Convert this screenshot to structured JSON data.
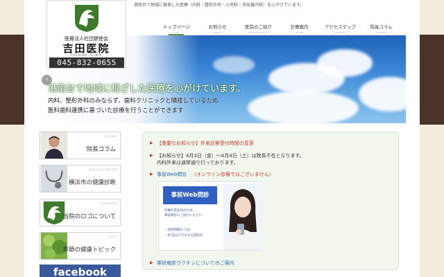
{
  "header": {
    "tagline": "港南台で地域に根差した医療（内科・整形外科・小児科・消化器内科）を心がけています。"
  },
  "logo": {
    "org": "医療法人社団健徳会",
    "name": "吉田医院",
    "en": "YOSHIDA CLINIC",
    "tel": "045-832-0655"
  },
  "nav": [
    {
      "jp": "トップページ",
      "en": "TOP"
    },
    {
      "jp": "お知らせ",
      "en": "NEWS"
    },
    {
      "jp": "医院のご紹介",
      "en": "INTRODUCTION"
    },
    {
      "jp": "診療案内",
      "en": "GUIDE"
    },
    {
      "jp": "アクセスマップ",
      "en": "ACCESS"
    },
    {
      "jp": "院長コラム",
      "en": "COLUMN"
    }
  ],
  "hero": {
    "title": "港南台で地域に根ざした医療を心がけています。",
    "sub1": "内科、整形外科のみならず、歯科クリニックと隣接しているため",
    "sub2": "医科歯科連携に基づいた診療を行うことができます",
    "prev": "‹"
  },
  "sidebar": [
    {
      "small": "COLUMN",
      "label": "院長コラム"
    },
    {
      "small": "MEDICAL CHECKUP",
      "label": "横浜市の健康診断"
    },
    {
      "small": "LOGOMARK",
      "label": "当院のロゴについて"
    },
    {
      "small": "TOPIC",
      "label": "季節の健康トピック"
    }
  ],
  "facebook": "facebook",
  "notice": {
    "item1_title": "【重要なお知らせ】外来診察受付時間の変更",
    "item2_line1": "【お知らせ】4月3日（金）〜4月4日（土）は院長不在となります。",
    "item2_line2": "内科外来は通常通り行っております。",
    "item3_title": "事前Web問診",
    "item3_note": "（オンライン診療ではございません）",
    "web_button": "事前Web問診",
    "web_desc1": "診察の充実化のため、",
    "web_desc2": "事前問診にご協力ください",
    "web_point1": "・回答時間3〜5分",
    "web_point2": "・PC又はスマホから回答可",
    "item4_title": "帯状疱疹ワクチンについてのご案内",
    "bullet": "▶"
  },
  "colors": {
    "accent_green": "#6a9a3a",
    "notice_red": "#c0392b",
    "band_brown": "#4a3226",
    "facebook_blue": "#3b5998"
  }
}
